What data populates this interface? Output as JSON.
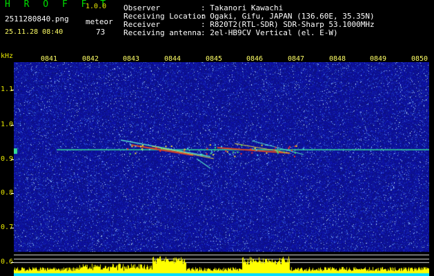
{
  "app": {
    "name": "H R O F F T",
    "version": "1.0.0",
    "filename": "2511280840.png",
    "category": "meteor",
    "count": "73",
    "datetime": "25.11.28 08:40"
  },
  "station": {
    "labels": [
      "Observer",
      "Receiving Location",
      "Receiver",
      "Receiving antenna"
    ],
    "values": [
      ": Takanori Kawachi",
      ": Ogaki, Gifu, JAPAN (136.60E, 35.35N)",
      ": R820T2(RTL-SDR) SDR-Sharp 53.1000MHz",
      ": 2el-HB9CV Vertical (el. E-W)"
    ]
  },
  "axes": {
    "y_unit": "kHz",
    "y_ticks": [
      "1.1",
      "1.0",
      "0.9",
      "0.8",
      "0.7",
      "0.6"
    ],
    "x_ticks": [
      "0841",
      "0842",
      "0843",
      "0844",
      "0845",
      "0846",
      "0847",
      "0848",
      "0849",
      "0850"
    ]
  },
  "colors": {
    "background": "#000000",
    "spectrum_base": "#1a1aa8",
    "carrier": "#33dd99",
    "power_fill": "#ffff00",
    "power_base": "#00ddff",
    "labels": "#ffff66"
  }
}
